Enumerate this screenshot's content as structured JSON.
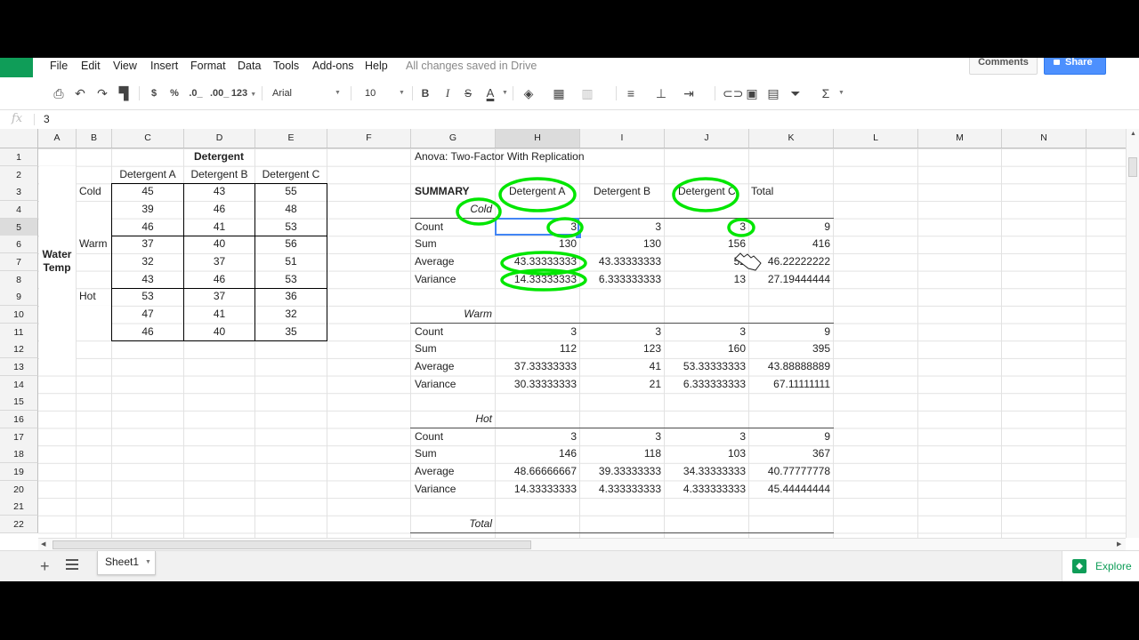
{
  "menu": {
    "items": [
      "File",
      "Edit",
      "View",
      "Insert",
      "Format",
      "Data",
      "Tools",
      "Add-ons",
      "Help"
    ],
    "status": "All changes saved in Drive",
    "comments": "Comments",
    "share": "Share"
  },
  "toolbar": {
    "currency": "$",
    "percent": "%",
    "dec_decrease": ".0_",
    "dec_increase": ".00_",
    "more_formats": "123",
    "font": "Arial",
    "font_size": "10",
    "bold": "B",
    "italic": "I",
    "strike": "S",
    "text_color": "A",
    "function": "Σ"
  },
  "formula_bar": {
    "fx": "fx",
    "value": "3"
  },
  "columns": [
    "A",
    "B",
    "C",
    "D",
    "E",
    "F",
    "G",
    "H",
    "I",
    "J",
    "K",
    "L",
    "M",
    "N"
  ],
  "rows": [
    "1",
    "2",
    "3",
    "4",
    "5",
    "6",
    "7",
    "8",
    "9",
    "10",
    "11",
    "12",
    "13",
    "14",
    "15",
    "16",
    "17",
    "18",
    "19",
    "20",
    "21",
    "22"
  ],
  "selected_cell": "H5",
  "left_table": {
    "title": "Detergent",
    "headers": [
      "Detergent A",
      "Detergent B",
      "Detergent C"
    ],
    "row_label": "Water Temp",
    "groups": [
      {
        "label": "Cold",
        "rows": [
          [
            "45",
            "43",
            "55"
          ],
          [
            "39",
            "46",
            "48"
          ],
          [
            "46",
            "41",
            "53"
          ]
        ]
      },
      {
        "label": "Warm",
        "rows": [
          [
            "37",
            "40",
            "56"
          ],
          [
            "32",
            "37",
            "51"
          ],
          [
            "43",
            "46",
            "53"
          ]
        ]
      },
      {
        "label": "Hot",
        "rows": [
          [
            "53",
            "37",
            "36"
          ],
          [
            "47",
            "41",
            "32"
          ],
          [
            "46",
            "40",
            "35"
          ]
        ]
      }
    ]
  },
  "anova": {
    "title": "Anova: Two-Factor With Replication",
    "summary_label": "SUMMARY",
    "headers": [
      "Detergent A",
      "Detergent B",
      "Detergent C",
      "Total"
    ],
    "blocks": [
      {
        "label": "Cold",
        "rows": [
          [
            "Count",
            "3",
            "3",
            "3",
            "9"
          ],
          [
            "Sum",
            "130",
            "130",
            "156",
            "416"
          ],
          [
            "Average",
            "43.33333333",
            "43.33333333",
            "52",
            "46.22222222"
          ],
          [
            "Variance",
            "14.33333333",
            "6.333333333",
            "13",
            "27.19444444"
          ]
        ]
      },
      {
        "label": "Warm",
        "rows": [
          [
            "Count",
            "3",
            "3",
            "3",
            "9"
          ],
          [
            "Sum",
            "112",
            "123",
            "160",
            "395"
          ],
          [
            "Average",
            "37.33333333",
            "41",
            "53.33333333",
            "43.88888889"
          ],
          [
            "Variance",
            "30.33333333",
            "21",
            "6.333333333",
            "67.11111111"
          ]
        ]
      },
      {
        "label": "Hot",
        "rows": [
          [
            "Count",
            "3",
            "3",
            "3",
            "9"
          ],
          [
            "Sum",
            "146",
            "118",
            "103",
            "367"
          ],
          [
            "Average",
            "48.66666667",
            "39.33333333",
            "34.33333333",
            "40.77777778"
          ],
          [
            "Variance",
            "14.33333333",
            "4.333333333",
            "4.333333333",
            "45.44444444"
          ]
        ]
      }
    ],
    "total_label": "Total"
  },
  "annotation_color": "#00e600",
  "sheet_tabs": {
    "active": "Sheet1",
    "explore": "Explore"
  }
}
